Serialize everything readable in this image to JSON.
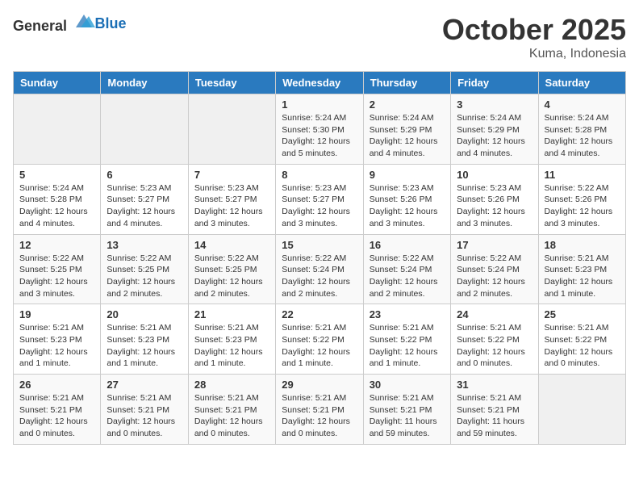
{
  "header": {
    "logo_general": "General",
    "logo_blue": "Blue",
    "month": "October 2025",
    "location": "Kuma, Indonesia"
  },
  "days_of_week": [
    "Sunday",
    "Monday",
    "Tuesday",
    "Wednesday",
    "Thursday",
    "Friday",
    "Saturday"
  ],
  "weeks": [
    [
      {
        "day": "",
        "sunrise": "",
        "sunset": "",
        "daylight": ""
      },
      {
        "day": "",
        "sunrise": "",
        "sunset": "",
        "daylight": ""
      },
      {
        "day": "",
        "sunrise": "",
        "sunset": "",
        "daylight": ""
      },
      {
        "day": "1",
        "sunrise": "Sunrise: 5:24 AM",
        "sunset": "Sunset: 5:30 PM",
        "daylight": "Daylight: 12 hours and 5 minutes."
      },
      {
        "day": "2",
        "sunrise": "Sunrise: 5:24 AM",
        "sunset": "Sunset: 5:29 PM",
        "daylight": "Daylight: 12 hours and 4 minutes."
      },
      {
        "day": "3",
        "sunrise": "Sunrise: 5:24 AM",
        "sunset": "Sunset: 5:29 PM",
        "daylight": "Daylight: 12 hours and 4 minutes."
      },
      {
        "day": "4",
        "sunrise": "Sunrise: 5:24 AM",
        "sunset": "Sunset: 5:28 PM",
        "daylight": "Daylight: 12 hours and 4 minutes."
      }
    ],
    [
      {
        "day": "5",
        "sunrise": "Sunrise: 5:24 AM",
        "sunset": "Sunset: 5:28 PM",
        "daylight": "Daylight: 12 hours and 4 minutes."
      },
      {
        "day": "6",
        "sunrise": "Sunrise: 5:23 AM",
        "sunset": "Sunset: 5:27 PM",
        "daylight": "Daylight: 12 hours and 4 minutes."
      },
      {
        "day": "7",
        "sunrise": "Sunrise: 5:23 AM",
        "sunset": "Sunset: 5:27 PM",
        "daylight": "Daylight: 12 hours and 3 minutes."
      },
      {
        "day": "8",
        "sunrise": "Sunrise: 5:23 AM",
        "sunset": "Sunset: 5:27 PM",
        "daylight": "Daylight: 12 hours and 3 minutes."
      },
      {
        "day": "9",
        "sunrise": "Sunrise: 5:23 AM",
        "sunset": "Sunset: 5:26 PM",
        "daylight": "Daylight: 12 hours and 3 minutes."
      },
      {
        "day": "10",
        "sunrise": "Sunrise: 5:23 AM",
        "sunset": "Sunset: 5:26 PM",
        "daylight": "Daylight: 12 hours and 3 minutes."
      },
      {
        "day": "11",
        "sunrise": "Sunrise: 5:22 AM",
        "sunset": "Sunset: 5:26 PM",
        "daylight": "Daylight: 12 hours and 3 minutes."
      }
    ],
    [
      {
        "day": "12",
        "sunrise": "Sunrise: 5:22 AM",
        "sunset": "Sunset: 5:25 PM",
        "daylight": "Daylight: 12 hours and 3 minutes."
      },
      {
        "day": "13",
        "sunrise": "Sunrise: 5:22 AM",
        "sunset": "Sunset: 5:25 PM",
        "daylight": "Daylight: 12 hours and 2 minutes."
      },
      {
        "day": "14",
        "sunrise": "Sunrise: 5:22 AM",
        "sunset": "Sunset: 5:25 PM",
        "daylight": "Daylight: 12 hours and 2 minutes."
      },
      {
        "day": "15",
        "sunrise": "Sunrise: 5:22 AM",
        "sunset": "Sunset: 5:24 PM",
        "daylight": "Daylight: 12 hours and 2 minutes."
      },
      {
        "day": "16",
        "sunrise": "Sunrise: 5:22 AM",
        "sunset": "Sunset: 5:24 PM",
        "daylight": "Daylight: 12 hours and 2 minutes."
      },
      {
        "day": "17",
        "sunrise": "Sunrise: 5:22 AM",
        "sunset": "Sunset: 5:24 PM",
        "daylight": "Daylight: 12 hours and 2 minutes."
      },
      {
        "day": "18",
        "sunrise": "Sunrise: 5:21 AM",
        "sunset": "Sunset: 5:23 PM",
        "daylight": "Daylight: 12 hours and 1 minute."
      }
    ],
    [
      {
        "day": "19",
        "sunrise": "Sunrise: 5:21 AM",
        "sunset": "Sunset: 5:23 PM",
        "daylight": "Daylight: 12 hours and 1 minute."
      },
      {
        "day": "20",
        "sunrise": "Sunrise: 5:21 AM",
        "sunset": "Sunset: 5:23 PM",
        "daylight": "Daylight: 12 hours and 1 minute."
      },
      {
        "day": "21",
        "sunrise": "Sunrise: 5:21 AM",
        "sunset": "Sunset: 5:23 PM",
        "daylight": "Daylight: 12 hours and 1 minute."
      },
      {
        "day": "22",
        "sunrise": "Sunrise: 5:21 AM",
        "sunset": "Sunset: 5:22 PM",
        "daylight": "Daylight: 12 hours and 1 minute."
      },
      {
        "day": "23",
        "sunrise": "Sunrise: 5:21 AM",
        "sunset": "Sunset: 5:22 PM",
        "daylight": "Daylight: 12 hours and 1 minute."
      },
      {
        "day": "24",
        "sunrise": "Sunrise: 5:21 AM",
        "sunset": "Sunset: 5:22 PM",
        "daylight": "Daylight: 12 hours and 0 minutes."
      },
      {
        "day": "25",
        "sunrise": "Sunrise: 5:21 AM",
        "sunset": "Sunset: 5:22 PM",
        "daylight": "Daylight: 12 hours and 0 minutes."
      }
    ],
    [
      {
        "day": "26",
        "sunrise": "Sunrise: 5:21 AM",
        "sunset": "Sunset: 5:21 PM",
        "daylight": "Daylight: 12 hours and 0 minutes."
      },
      {
        "day": "27",
        "sunrise": "Sunrise: 5:21 AM",
        "sunset": "Sunset: 5:21 PM",
        "daylight": "Daylight: 12 hours and 0 minutes."
      },
      {
        "day": "28",
        "sunrise": "Sunrise: 5:21 AM",
        "sunset": "Sunset: 5:21 PM",
        "daylight": "Daylight: 12 hours and 0 minutes."
      },
      {
        "day": "29",
        "sunrise": "Sunrise: 5:21 AM",
        "sunset": "Sunset: 5:21 PM",
        "daylight": "Daylight: 12 hours and 0 minutes."
      },
      {
        "day": "30",
        "sunrise": "Sunrise: 5:21 AM",
        "sunset": "Sunset: 5:21 PM",
        "daylight": "Daylight: 11 hours and 59 minutes."
      },
      {
        "day": "31",
        "sunrise": "Sunrise: 5:21 AM",
        "sunset": "Sunset: 5:21 PM",
        "daylight": "Daylight: 11 hours and 59 minutes."
      },
      {
        "day": "",
        "sunrise": "",
        "sunset": "",
        "daylight": ""
      }
    ]
  ]
}
